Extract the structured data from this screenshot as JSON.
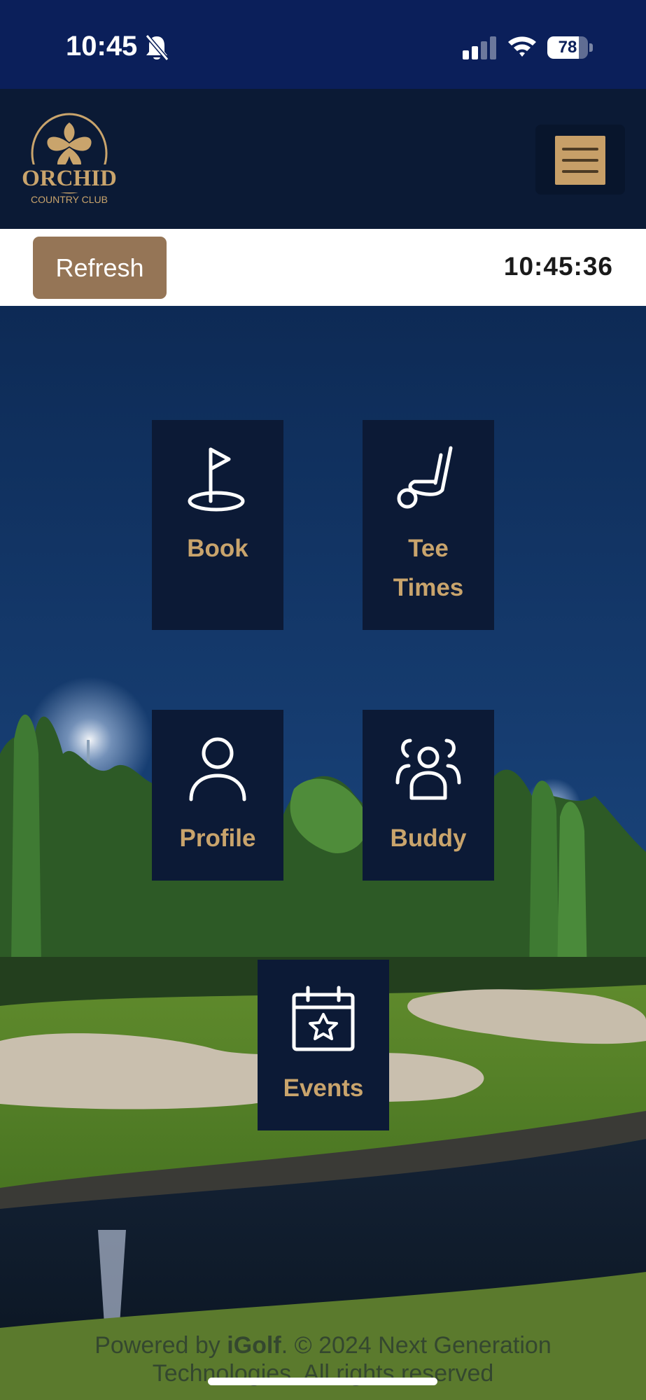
{
  "status_bar": {
    "time": "10:45",
    "battery_level": "78",
    "battery_fraction": 0.78,
    "icons": [
      "bell-slash-icon",
      "cellular-signal-icon",
      "wifi-icon",
      "battery-icon"
    ]
  },
  "header": {
    "logo_word": "ORCHID",
    "logo_subtitle": "COUNTRY CLUB",
    "menu_icon": "hamburger-menu-icon"
  },
  "toolbar": {
    "refresh_label": "Refresh",
    "clock": "10:45:36"
  },
  "tiles": [
    {
      "label": "Book",
      "icon": "golf-flag-icon"
    },
    {
      "label_line1": "Tee",
      "label_line2": "Times",
      "icon": "golf-club-icon"
    },
    {
      "label": "Profile",
      "icon": "user-icon"
    },
    {
      "label": "Buddy",
      "icon": "users-group-icon"
    },
    {
      "label": "Events",
      "icon": "calendar-star-icon"
    }
  ],
  "footer": {
    "prefix": "Powered by ",
    "brand": "iGolf",
    "suffix": ". © 2024 Next Generation",
    "line2": "Technologies. All rights reserved"
  },
  "colors": {
    "status_bar_bg": "#0b1f5a",
    "header_bg": "#0b1a35",
    "tile_bg": "#0c1a36",
    "accent_gold": "#c9a46c",
    "refresh_button_bg": "#957556"
  }
}
